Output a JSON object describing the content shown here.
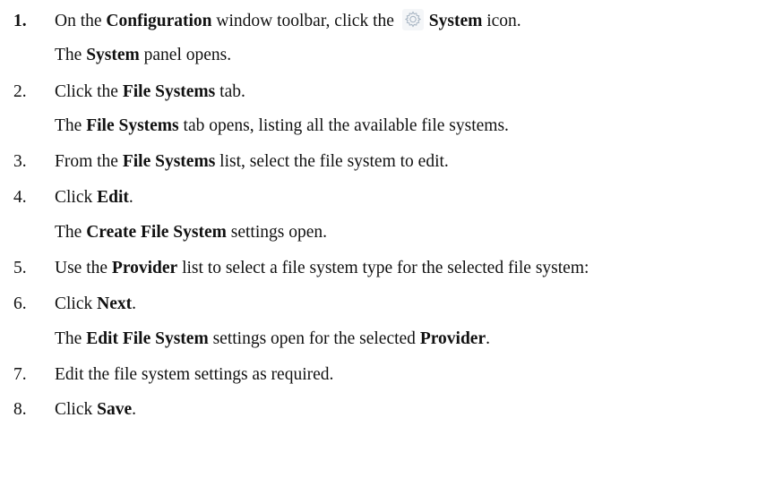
{
  "steps": [
    {
      "num": "1.",
      "text": {
        "a": "On the ",
        "b": "Configuration",
        "c": " window toolbar, click the ",
        "icon": "gear-icon",
        "d": "System",
        "e": " icon."
      },
      "result": {
        "a": "The ",
        "b": "System",
        "c": " panel opens."
      }
    },
    {
      "num": "2.",
      "text": {
        "a": "Click the ",
        "b": "File Systems",
        "c": " tab."
      },
      "result": {
        "a": "The ",
        "b": "File Systems",
        "c": " tab opens, listing all the available file systems."
      }
    },
    {
      "num": "3.",
      "text": {
        "a": "From the ",
        "b": "File Systems",
        "c": " list, select the file system to edit."
      }
    },
    {
      "num": "4.",
      "text": {
        "a": "Click ",
        "b": "Edit",
        "c": "."
      },
      "result": {
        "a": "The ",
        "b": "Create File System",
        "c": " settings open."
      }
    },
    {
      "num": "5.",
      "text": {
        "a": "Use the ",
        "b": "Provider",
        "c": " list to select a file system type for the selected file system:"
      }
    },
    {
      "num": "6.",
      "text": {
        "a": "Click ",
        "b": "Next",
        "c": "."
      },
      "result": {
        "a": "The ",
        "b": "Edit File System",
        "c": " settings open for the selected ",
        "d": "Provider",
        "e": "."
      }
    },
    {
      "num": "7.",
      "text": {
        "a": "Edit the file system settings as required."
      }
    },
    {
      "num": "8.",
      "text": {
        "a": "Click ",
        "b": "Save",
        "c": "."
      }
    }
  ]
}
